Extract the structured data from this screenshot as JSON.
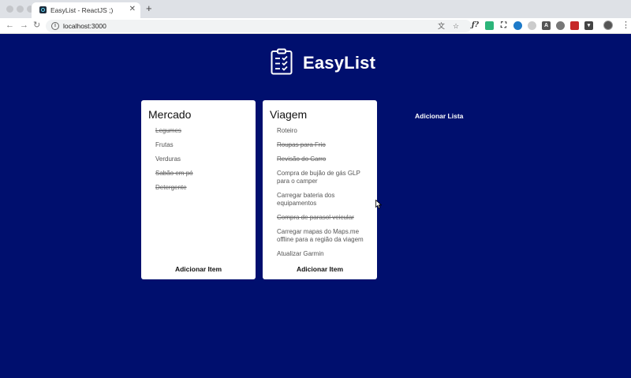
{
  "browser": {
    "tab_title": "EasyList - ReactJS ;)",
    "url": "localhost:3000",
    "extensions": [
      "translate-icon",
      "star-icon",
      "fx-icon",
      "puzzle-icon",
      "screenshot-icon",
      "blue-ext-icon",
      "gray-ext-icon",
      "a-ext-icon",
      "grey-circle-icon",
      "red-ext-icon",
      "v-ext-icon"
    ]
  },
  "app": {
    "title": "EasyList",
    "add_list_label": "Adicionar Lista",
    "add_item_label": "Adicionar Item"
  },
  "lists": [
    {
      "title": "Mercado",
      "items": [
        {
          "text": "Legumes",
          "done": true
        },
        {
          "text": "Frutas",
          "done": false
        },
        {
          "text": "Verduras",
          "done": false
        },
        {
          "text": "Sabão em pó",
          "done": true
        },
        {
          "text": "Detergente",
          "done": true
        }
      ]
    },
    {
      "title": "Viagem",
      "items": [
        {
          "text": "Roteiro",
          "done": false
        },
        {
          "text": "Roupas para Frio",
          "done": true
        },
        {
          "text": "Revisão do Carro",
          "done": true
        },
        {
          "text": "Compra de bujão de gás GLP para o camper",
          "done": false
        },
        {
          "text": "Carregar bateria dos equipamentos",
          "done": false
        },
        {
          "text": "Compra de parasol veicular",
          "done": true
        },
        {
          "text": "Carregar mapas do Maps.me offline para a região da viagem",
          "done": false
        },
        {
          "text": "Atualizar Garmin",
          "done": false
        }
      ]
    }
  ]
}
